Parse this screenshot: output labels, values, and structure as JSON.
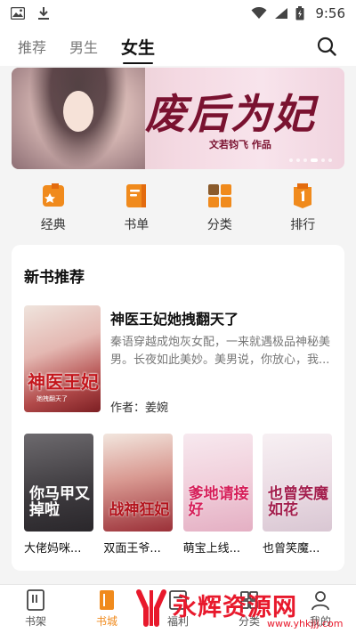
{
  "status_bar": {
    "time": "9:56",
    "icons": [
      "image-icon",
      "download-icon",
      "wifi-icon",
      "signal-icon",
      "battery-icon"
    ]
  },
  "top_nav": {
    "tabs": [
      {
        "label": "推荐",
        "active": false
      },
      {
        "label": "男生",
        "active": false
      },
      {
        "label": "女生",
        "active": true
      }
    ],
    "search_icon": "search-icon"
  },
  "banner": {
    "title": "废后为妃",
    "author": "文若钧飞 作品"
  },
  "quick": [
    {
      "label": "经典",
      "icon": "classic-icon",
      "color": "#f08a1c"
    },
    {
      "label": "书单",
      "icon": "booklist-icon",
      "color": "#f08a1c"
    },
    {
      "label": "分类",
      "icon": "category-icon",
      "color": "#f08a1c"
    },
    {
      "label": "排行",
      "icon": "ranking-icon",
      "color": "#f08a1c"
    }
  ],
  "new_books": {
    "section_title": "新书推荐",
    "featured": {
      "title": "神医王妃她拽翻天了",
      "desc": "秦语穿越成炮灰女配，一来就遇极品神秘美男。长夜如此美妙。美男说，你放心，我...",
      "author_key": "作者：",
      "author": "姜婉",
      "cover_text": "神医王妃",
      "cover_sub": "她拽翻天了"
    },
    "books": [
      {
        "name": "大佬妈咪...",
        "cover_text": "你马甲又掉啦"
      },
      {
        "name": "双面王爷...",
        "cover_text": "战神狂妃"
      },
      {
        "name": "萌宝上线...",
        "cover_text": "爹地请接好"
      },
      {
        "name": "也曾笑魔...",
        "cover_text": "也曾笑魔如花"
      }
    ]
  },
  "bottom_nav": [
    {
      "label": "书架",
      "icon": "bookshelf-icon",
      "active": false
    },
    {
      "label": "书城",
      "icon": "bookstore-icon",
      "active": true
    },
    {
      "label": "福利",
      "icon": "welfare-icon",
      "active": false
    },
    {
      "label": "分类",
      "icon": "category-icon",
      "active": false
    },
    {
      "label": "我的",
      "icon": "profile-icon",
      "active": false
    }
  ],
  "watermark": {
    "text": "永辉资源网",
    "url": "www.yhkjjj.com"
  },
  "colors": {
    "accent": "#f08a1c",
    "watermark": "#e8192c"
  }
}
